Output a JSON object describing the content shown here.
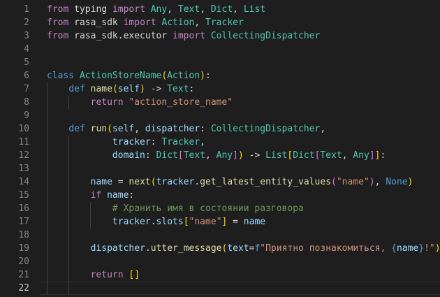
{
  "editor": {
    "active_line": "22",
    "line_numbers": [
      "1",
      "2",
      "3",
      "4",
      "5",
      "6",
      "7",
      "8",
      "9",
      "10",
      "11",
      "12",
      "13",
      "14",
      "15",
      "16",
      "17",
      "18",
      "19",
      "20",
      "21",
      "22"
    ],
    "lines": [
      [
        [
          "kw",
          "from"
        ],
        [
          "pl",
          " typing "
        ],
        [
          "kw",
          "import"
        ],
        [
          "pl",
          " "
        ],
        [
          "cls",
          "Any"
        ],
        [
          "pl",
          ", "
        ],
        [
          "cls",
          "Text"
        ],
        [
          "pl",
          ", "
        ],
        [
          "cls",
          "Dict"
        ],
        [
          "pl",
          ", "
        ],
        [
          "cls",
          "List"
        ]
      ],
      [
        [
          "kw",
          "from"
        ],
        [
          "pl",
          " rasa_sdk "
        ],
        [
          "kw",
          "import"
        ],
        [
          "pl",
          " "
        ],
        [
          "cls",
          "Action"
        ],
        [
          "pl",
          ", "
        ],
        [
          "cls",
          "Tracker"
        ]
      ],
      [
        [
          "kw",
          "from"
        ],
        [
          "pl",
          " rasa_sdk.executor "
        ],
        [
          "kw",
          "import"
        ],
        [
          "pl",
          " "
        ],
        [
          "cls",
          "CollectingDispatcher"
        ]
      ],
      [],
      [],
      [
        [
          "kw2",
          "class"
        ],
        [
          "pl",
          " "
        ],
        [
          "cls",
          "ActionStoreName"
        ],
        [
          "br1",
          "("
        ],
        [
          "cls",
          "Action"
        ],
        [
          "br1",
          ")"
        ],
        [
          "pl",
          ":"
        ]
      ],
      [
        [
          "pl",
          "    "
        ],
        [
          "kw2",
          "def"
        ],
        [
          "pl",
          " "
        ],
        [
          "fn",
          "name"
        ],
        [
          "br1",
          "("
        ],
        [
          "var",
          "self"
        ],
        [
          "br1",
          ")"
        ],
        [
          "pl",
          " -> "
        ],
        [
          "cls",
          "Text"
        ],
        [
          "pl",
          ":"
        ]
      ],
      [
        [
          "pl",
          "        "
        ],
        [
          "kw",
          "return"
        ],
        [
          "pl",
          " "
        ],
        [
          "str",
          "\"action_store_name\""
        ]
      ],
      [],
      [
        [
          "pl",
          "    "
        ],
        [
          "kw2",
          "def"
        ],
        [
          "pl",
          " "
        ],
        [
          "fn",
          "run"
        ],
        [
          "br1",
          "("
        ],
        [
          "var",
          "self"
        ],
        [
          "pl",
          ", "
        ],
        [
          "var",
          "dispatcher"
        ],
        [
          "pl",
          ": "
        ],
        [
          "cls",
          "CollectingDispatcher"
        ],
        [
          "pl",
          ","
        ]
      ],
      [
        [
          "pl",
          "            "
        ],
        [
          "var",
          "tracker"
        ],
        [
          "pl",
          ": "
        ],
        [
          "cls",
          "Tracker"
        ],
        [
          "pl",
          ","
        ]
      ],
      [
        [
          "pl",
          "            "
        ],
        [
          "var",
          "domain"
        ],
        [
          "pl",
          ": "
        ],
        [
          "cls",
          "Dict"
        ],
        [
          "br2",
          "["
        ],
        [
          "cls",
          "Text"
        ],
        [
          "pl",
          ", "
        ],
        [
          "cls",
          "Any"
        ],
        [
          "br2",
          "]"
        ],
        [
          "br1",
          ")"
        ],
        [
          "pl",
          " -> "
        ],
        [
          "cls",
          "List"
        ],
        [
          "br1",
          "["
        ],
        [
          "cls",
          "Dict"
        ],
        [
          "br2",
          "["
        ],
        [
          "cls",
          "Text"
        ],
        [
          "pl",
          ", "
        ],
        [
          "cls",
          "Any"
        ],
        [
          "br2",
          "]"
        ],
        [
          "br1",
          "]"
        ],
        [
          "pl",
          ":"
        ]
      ],
      [],
      [
        [
          "pl",
          "        "
        ],
        [
          "var",
          "name"
        ],
        [
          "pl",
          " = "
        ],
        [
          "fn",
          "next"
        ],
        [
          "br1",
          "("
        ],
        [
          "var",
          "tracker"
        ],
        [
          "pl",
          "."
        ],
        [
          "fn",
          "get_latest_entity_values"
        ],
        [
          "br2",
          "("
        ],
        [
          "str",
          "\"name\""
        ],
        [
          "br2",
          ")"
        ],
        [
          "pl",
          ", "
        ],
        [
          "kw2",
          "None"
        ],
        [
          "br1",
          ")"
        ]
      ],
      [
        [
          "pl",
          "        "
        ],
        [
          "kw",
          "if"
        ],
        [
          "pl",
          " "
        ],
        [
          "var",
          "name"
        ],
        [
          "pl",
          ":"
        ]
      ],
      [
        [
          "pl",
          "            "
        ],
        [
          "cmt",
          "# Хранить имя в состоянии разговора"
        ]
      ],
      [
        [
          "pl",
          "            "
        ],
        [
          "var",
          "tracker"
        ],
        [
          "pl",
          "."
        ],
        [
          "var",
          "slots"
        ],
        [
          "br1",
          "["
        ],
        [
          "str",
          "\"name\""
        ],
        [
          "br1",
          "]"
        ],
        [
          "pl",
          " = "
        ],
        [
          "var",
          "name"
        ]
      ],
      [],
      [
        [
          "pl",
          "        "
        ],
        [
          "var",
          "dispatcher"
        ],
        [
          "pl",
          "."
        ],
        [
          "fn",
          "utter_message"
        ],
        [
          "br1",
          "("
        ],
        [
          "var",
          "text"
        ],
        [
          "pl",
          "="
        ],
        [
          "kw2",
          "f"
        ],
        [
          "str",
          "\"Приятно познакомиться, "
        ],
        [
          "kw2",
          "{"
        ],
        [
          "var",
          "name"
        ],
        [
          "kw2",
          "}"
        ],
        [
          "str",
          "!\""
        ],
        [
          "br1",
          ")"
        ]
      ],
      [],
      [
        [
          "pl",
          "        "
        ],
        [
          "kw",
          "return"
        ],
        [
          "pl",
          " "
        ],
        [
          "br1",
          "["
        ],
        [
          "br1",
          "]"
        ]
      ],
      []
    ]
  }
}
